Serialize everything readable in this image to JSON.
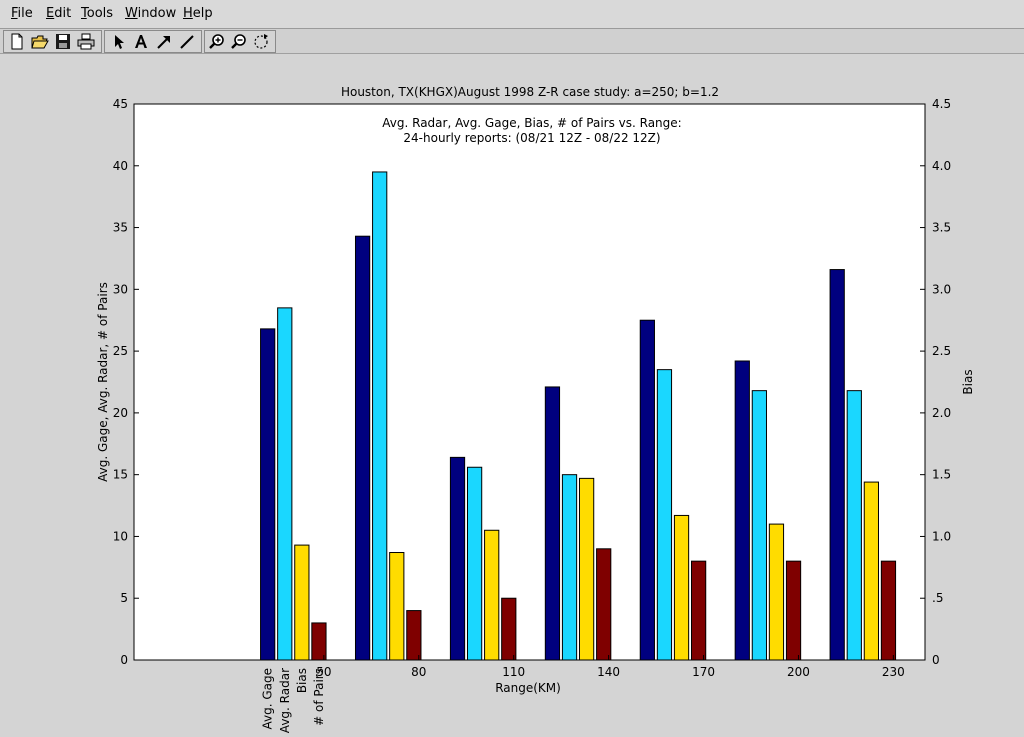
{
  "menubar": {
    "items": [
      {
        "mnemonic": "F",
        "rest": "ile"
      },
      {
        "mnemonic": "E",
        "rest": "dit"
      },
      {
        "mnemonic": "T",
        "rest": "ools"
      },
      {
        "mnemonic": "W",
        "rest": "indow"
      },
      {
        "mnemonic": "H",
        "rest": "elp"
      }
    ]
  },
  "toolbar": {
    "buttons": [
      "new-file-icon",
      "open-folder-icon",
      "save-icon",
      "print-icon",
      "pointer-arrow-icon",
      "text-tool-icon",
      "arrow-tool-icon",
      "line-tool-icon",
      "zoom-in-icon",
      "zoom-out-icon",
      "rotate-icon"
    ]
  },
  "colors": {
    "avg_gage": "#00007f",
    "avg_radar": "#1ad7ff",
    "bias": "#ffdc00",
    "pairs": "#7f0000"
  },
  "chart_data": {
    "type": "bar",
    "title": "Houston, TX(KHGX)August 1998 Z-R case study: a=250; b=1.2",
    "subtitle": [
      "Avg. Radar, Avg. Gage, Bias, # of Pairs vs. Range:",
      "24-hourly reports: (08/21 12Z - 08/22 12Z)"
    ],
    "xlabel": "Range(KM)",
    "ylabel_left": "Avg. Gage, Avg. Radar, # of Pairs",
    "ylabel_right": "Bias",
    "xlim": [
      -10,
      240
    ],
    "x_ticks": [
      50,
      80,
      110,
      140,
      170,
      200,
      230
    ],
    "ylim_left": [
      0,
      45
    ],
    "y_ticks_left": [
      0,
      5,
      10,
      15,
      20,
      25,
      30,
      35,
      40,
      45
    ],
    "ylim_right": [
      0,
      4.5
    ],
    "y_ticks_right": [
      "0",
      ".5",
      "1.0",
      "1.5",
      "2.0",
      "2.5",
      "3.0",
      "3.5",
      "4.0",
      "4.5"
    ],
    "group_starts": [
      30,
      60,
      90,
      120,
      150,
      180,
      210
    ],
    "bar_width_x": 4.5,
    "bar_step_x": 5.4,
    "series_labels": [
      "Avg. Gage",
      "Avg. Radar",
      "Bias",
      "# of Pairs"
    ],
    "series": [
      {
        "name": "Avg. Gage",
        "axis": "left",
        "values": [
          26.8,
          34.3,
          16.4,
          22.1,
          27.5,
          24.2,
          31.6
        ]
      },
      {
        "name": "Avg. Radar",
        "axis": "left",
        "values": [
          28.5,
          39.5,
          15.6,
          15.0,
          23.5,
          21.8,
          21.8
        ]
      },
      {
        "name": "Bias",
        "axis": "right",
        "values": [
          0.93,
          0.87,
          1.05,
          1.47,
          1.17,
          1.1,
          1.44
        ]
      },
      {
        "name": "# of Pairs",
        "axis": "left",
        "values": [
          3,
          4,
          5,
          9,
          8,
          8,
          8
        ]
      }
    ],
    "grid": false
  }
}
